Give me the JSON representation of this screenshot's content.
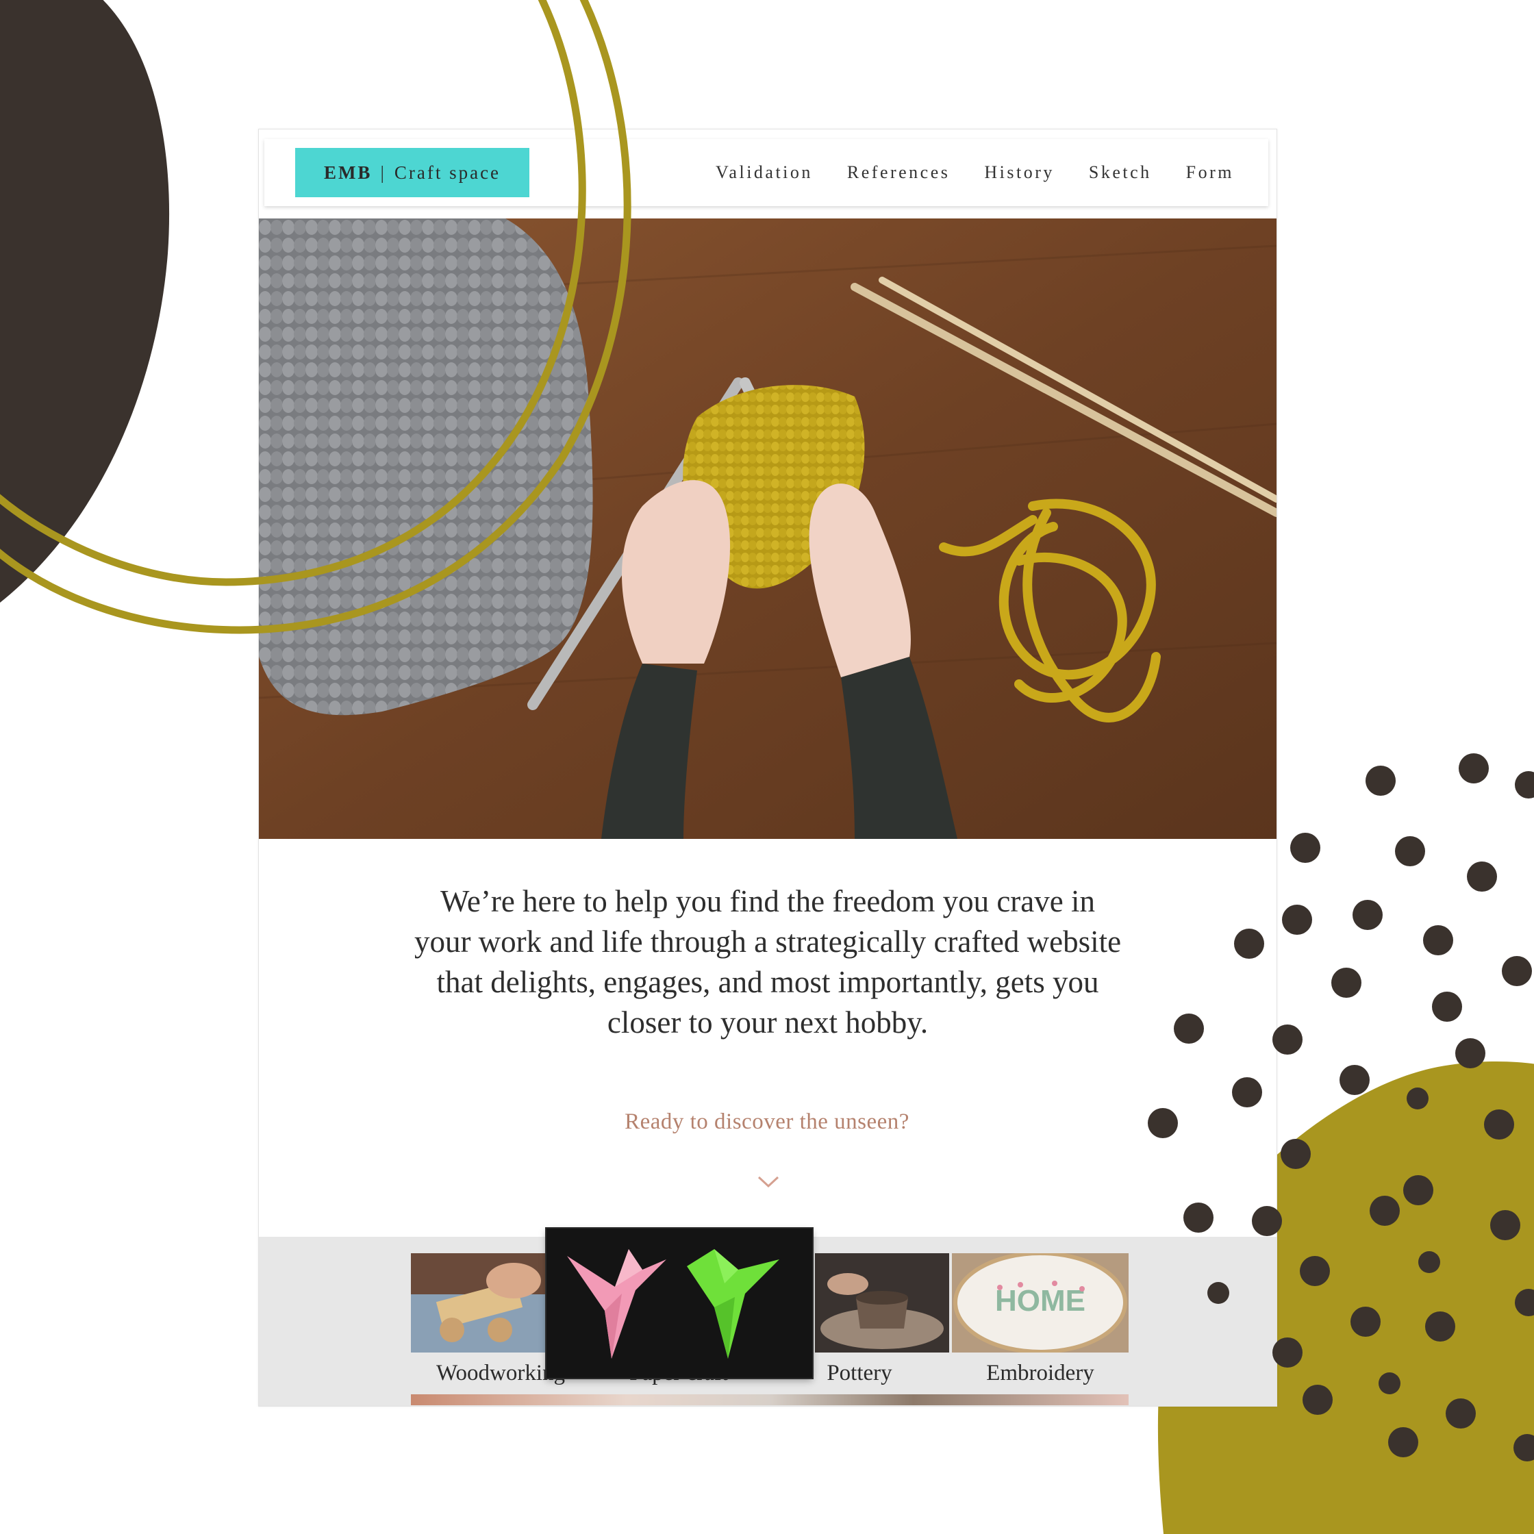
{
  "site": {
    "logo": {
      "brand": "EMB",
      "separator": "|",
      "name": "Craft space"
    },
    "nav": [
      "Validation",
      "References",
      "History",
      "Sketch",
      "Form"
    ],
    "tagline": "We’re here to help you find the freedom you crave in your work and life through a strategically crafted website that delights, engages, and most importantly, gets you closer to your next hobby.",
    "cta": "Ready to discover the unseen?",
    "gallery": [
      {
        "label": "Woodworking",
        "icon": "woodworking-image"
      },
      {
        "label": "Paper craft",
        "icon": "paper-craft-image"
      },
      {
        "label": "Pottery",
        "icon": "pottery-image"
      },
      {
        "label": "Embroidery",
        "icon": "embroidery-image"
      }
    ]
  },
  "colors": {
    "accent_teal": "#4dd6d2",
    "olive": "#a9961f",
    "dark_brown": "#3a322d",
    "cta_text": "#b5826e"
  }
}
